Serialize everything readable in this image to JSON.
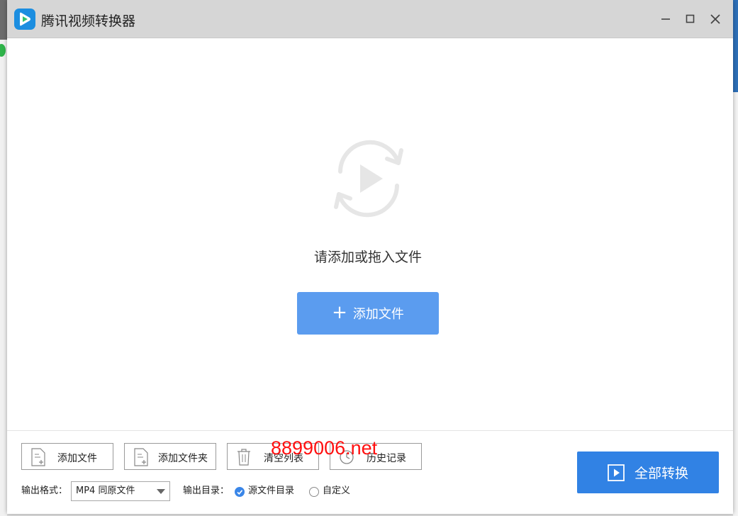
{
  "window": {
    "title": "腾讯视频转换器"
  },
  "main": {
    "empty_hint": "请添加或拖入文件",
    "add_file_button": "添加文件"
  },
  "toolbar": {
    "add_file": "添加文件",
    "add_folder": "添加文件夹",
    "clear_list": "清空列表",
    "history": "历史记录"
  },
  "output": {
    "format_label": "输出格式：",
    "format_value": "MP4 同原文件",
    "dir_label": "输出目录：",
    "dir_option_source": "源文件目录",
    "dir_option_custom": "自定义",
    "selected_dir": "源文件目录"
  },
  "convert_all_button": "全部转换",
  "watermark": "8899006.net",
  "colors": {
    "accent": "#3182e4",
    "add_button": "#5b9cef",
    "titlebar": "#d6d6d6",
    "watermark": "#ff1010"
  },
  "icons": {
    "app": "tencent-video-logo",
    "hero": "convert-play-icon",
    "minimize": "minimize-icon",
    "maximize": "maximize-icon",
    "close": "close-icon"
  }
}
